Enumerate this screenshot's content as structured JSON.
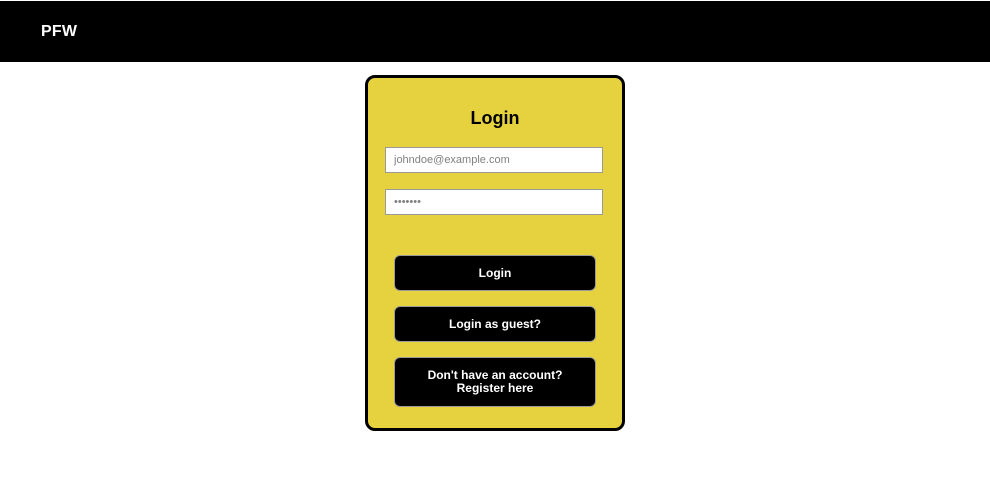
{
  "navbar": {
    "brand": "PFW"
  },
  "login_form": {
    "title": "Login",
    "email_placeholder": "johndoe@example.com",
    "password_placeholder": "•••••••",
    "login_button": "Login",
    "guest_button": "Login as guest?",
    "register_button": "Don't have an account? Register here"
  },
  "colors": {
    "navbar_bg": "#000000",
    "card_bg": "#e6d23e",
    "button_bg": "#000000",
    "button_text": "#ffffff"
  }
}
